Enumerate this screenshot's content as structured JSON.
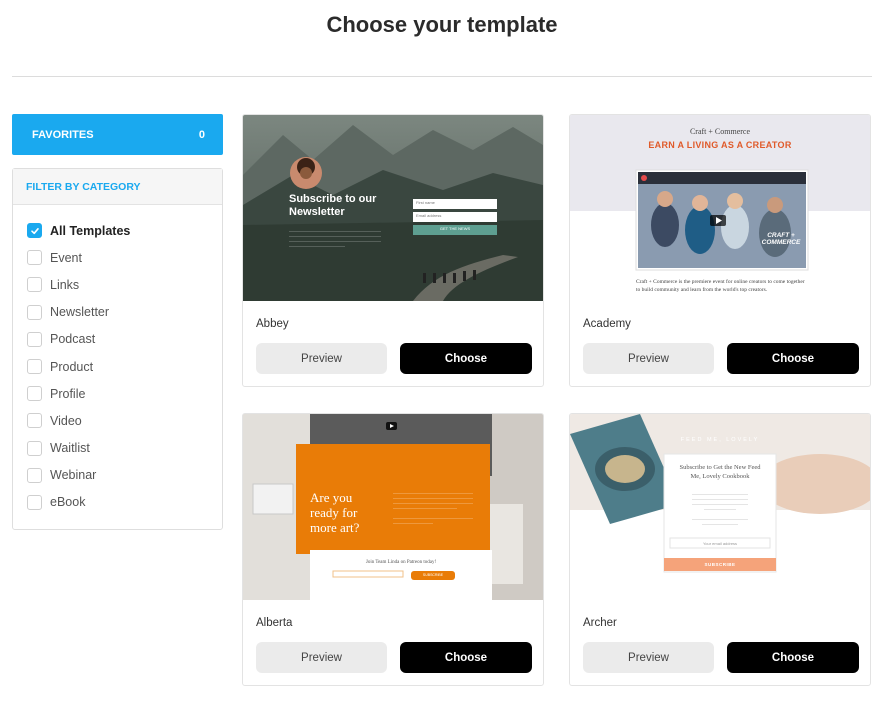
{
  "header": {
    "title": "Choose your template"
  },
  "sidebar": {
    "favorites": {
      "label": "FAVORITES",
      "count": "0"
    },
    "filter_title": "FILTER BY CATEGORY",
    "categories": [
      {
        "label": "All Templates",
        "checked": true
      },
      {
        "label": "Event",
        "checked": false
      },
      {
        "label": "Links",
        "checked": false
      },
      {
        "label": "Newsletter",
        "checked": false
      },
      {
        "label": "Podcast",
        "checked": false
      },
      {
        "label": "Product",
        "checked": false
      },
      {
        "label": "Profile",
        "checked": false
      },
      {
        "label": "Video",
        "checked": false
      },
      {
        "label": "Waitlist",
        "checked": false
      },
      {
        "label": "Webinar",
        "checked": false
      },
      {
        "label": "eBook",
        "checked": false
      }
    ]
  },
  "templates": [
    {
      "name": "Abbey",
      "preview_label": "Preview",
      "choose_label": "Choose",
      "thumb": {
        "heading": "Subscribe to our Newsletter",
        "field1": "First name",
        "field2": "Email address",
        "button": "GET THE NEWS"
      }
    },
    {
      "name": "Academy",
      "preview_label": "Preview",
      "choose_label": "Choose",
      "thumb": {
        "brand": "Craft + Commerce",
        "headline": "EARN A LIVING AS A CREATOR",
        "video_badge": "CRAFT + COMMERCE",
        "caption": "Craft + Commerce is the premiere event for online creators to come together to build community and learn from the world's top creators."
      }
    },
    {
      "name": "Alberta",
      "preview_label": "Preview",
      "choose_label": "Choose",
      "thumb": {
        "heading": "Are you ready for more art?",
        "join": "Join Team Linda on Patreon today!",
        "button": "SUBSCRIBE"
      }
    },
    {
      "name": "Archer",
      "preview_label": "Preview",
      "choose_label": "Choose",
      "thumb": {
        "brand": "FEED ME, LOVELY",
        "heading": "Subscribe to Get the New Feed Me, Lovely Cookbook",
        "input": "Your email address",
        "button": "SUBSCRIBE"
      }
    }
  ],
  "colors": {
    "accent": "#1aa9ef",
    "choose_bg": "#000000",
    "preview_bg": "#ebebeb",
    "alberta_orange": "#e97c07",
    "archer_peach": "#f5a37a"
  }
}
